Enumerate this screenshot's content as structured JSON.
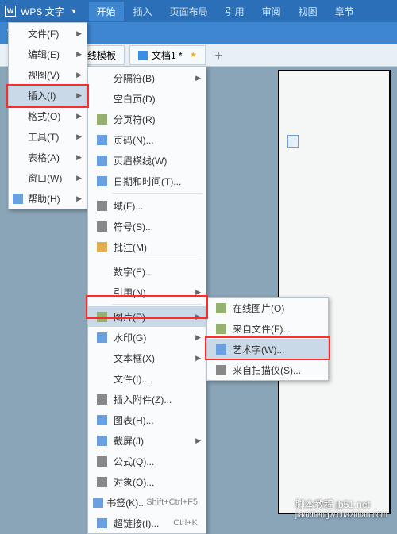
{
  "app": {
    "name": "WPS 文字"
  },
  "tabs": [
    "开始",
    "插入",
    "页面布局",
    "引用",
    "审阅",
    "视图",
    "章节"
  ],
  "docbar": {
    "items": [
      {
        "label": "Docer-在线模板"
      },
      {
        "label": "文档1 *"
      }
    ]
  },
  "menu1": {
    "items": [
      {
        "label": "文件(F)",
        "sub": true
      },
      {
        "label": "编辑(E)",
        "sub": true
      },
      {
        "label": "视图(V)",
        "sub": true
      },
      {
        "label": "插入(I)",
        "sub": true,
        "hl": true
      },
      {
        "label": "格式(O)",
        "sub": true
      },
      {
        "label": "工具(T)",
        "sub": true
      },
      {
        "label": "表格(A)",
        "sub": true
      },
      {
        "label": "窗口(W)",
        "sub": true
      },
      {
        "label": "帮助(H)",
        "sub": true,
        "help": true
      }
    ]
  },
  "menu2": {
    "groups": [
      [
        {
          "label": "分隔符(B)",
          "sub": true
        },
        {
          "label": "空白页(D)"
        },
        {
          "label": "分页符(R)",
          "icon": "g"
        },
        {
          "label": "页码(N)...",
          "icon": "sq"
        },
        {
          "label": "页眉横线(W)",
          "icon": "sq"
        },
        {
          "label": "日期和时间(T)...",
          "icon": "sq"
        }
      ],
      [
        {
          "label": "域(F)...",
          "icon": "gr"
        },
        {
          "label": "符号(S)...",
          "icon": "gr"
        },
        {
          "label": "批注(M)",
          "icon": "y"
        }
      ],
      [
        {
          "label": "数字(E)..."
        },
        {
          "label": "引用(N)",
          "sub": true
        }
      ],
      [
        {
          "label": "图片(P)",
          "sub": true,
          "icon": "g",
          "hl": true
        },
        {
          "label": "水印(G)",
          "sub": true,
          "icon": "sq"
        },
        {
          "label": "文本框(X)",
          "sub": true
        },
        {
          "label": "文件(I)..."
        },
        {
          "label": "插入附件(Z)...",
          "icon": "gr"
        },
        {
          "label": "图表(H)...",
          "icon": "sq"
        },
        {
          "label": "截屏(J)",
          "sub": true,
          "icon": "sq"
        },
        {
          "label": "公式(Q)...",
          "icon": "gr"
        },
        {
          "label": "对象(O)...",
          "icon": "gr"
        },
        {
          "label": "书签(K)...",
          "icon": "sq",
          "shortcut": "Shift+Ctrl+F5"
        },
        {
          "label": "超链接(I)...",
          "icon": "sq",
          "shortcut": "Ctrl+K"
        }
      ]
    ]
  },
  "menu3": {
    "items": [
      {
        "label": "在线图片(O)",
        "icon": "g"
      },
      {
        "label": "来自文件(F)...",
        "icon": "g"
      },
      {
        "label": "艺术字(W)...",
        "icon": "sq",
        "hl": true
      },
      {
        "label": "来自扫描仪(S)...",
        "icon": "gr"
      }
    ]
  },
  "watermark": {
    "main": "脚本教程 jb51.net",
    "sub": "jiaochengw.chazidian.com"
  }
}
